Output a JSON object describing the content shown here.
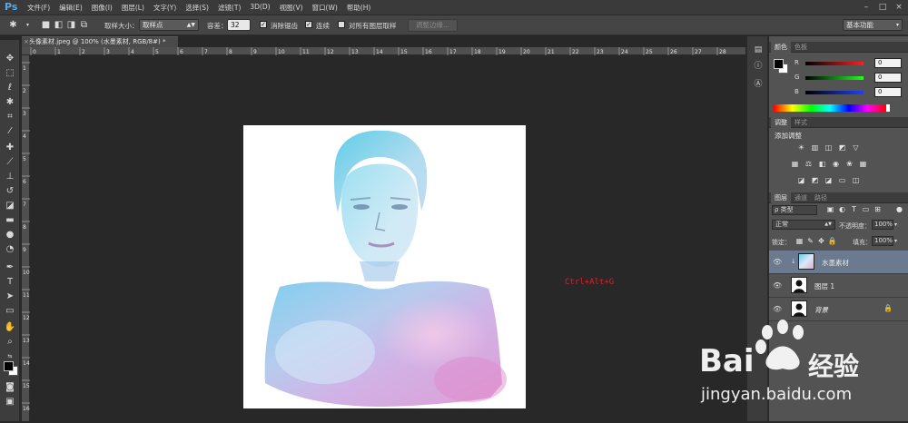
{
  "app": {
    "logo": "Ps"
  },
  "menu": [
    "文件(F)",
    "编辑(E)",
    "图像(I)",
    "图层(L)",
    "文字(Y)",
    "选择(S)",
    "滤镜(T)",
    "3D(D)",
    "视图(V)",
    "窗口(W)",
    "帮助(H)"
  ],
  "options": {
    "sample_size_label": "取样大小：",
    "sample_size_value": "取样点",
    "tolerance_label": "容差：",
    "tolerance_value": "32",
    "antialias_label": "消除锯齿",
    "contiguous_label": "连续",
    "all_layers_label": "对所有图层取样",
    "refine_edge_label": "调整边缘...",
    "workspace_value": "基本功能"
  },
  "document": {
    "tab_title": "头像素材.jpeg @ 100% (水墨素材, RGB/8#) *",
    "tab_close": "×"
  },
  "ruler_h_labels": [
    "0",
    "1",
    "2",
    "3",
    "4",
    "5",
    "6",
    "7",
    "8",
    "9",
    "10",
    "11",
    "12",
    "13",
    "14",
    "15",
    "16",
    "17",
    "18",
    "19",
    "20",
    "21",
    "22",
    "23",
    "24",
    "25",
    "26",
    "27",
    "28",
    "29"
  ],
  "ruler_v_labels": [
    "1",
    "2",
    "3",
    "4",
    "5",
    "6",
    "7",
    "8",
    "9",
    "10",
    "11",
    "12",
    "13",
    "14",
    "15",
    "16"
  ],
  "annotation_text": "Ctrl+Alt+G",
  "color_panel": {
    "tabs": [
      "颜色",
      "色板"
    ],
    "channels": [
      {
        "name": "R",
        "value": "0",
        "color": "#d83030"
      },
      {
        "name": "G",
        "value": "0",
        "color": "#30c030"
      },
      {
        "name": "B",
        "value": "0",
        "color": "#3040e0"
      }
    ]
  },
  "adjust_panel": {
    "tabs": [
      "调整",
      "样式"
    ],
    "heading": "添加调整"
  },
  "layers_panel": {
    "tabs": [
      "图层",
      "通道",
      "路径"
    ],
    "kind_label": "ρ 类型",
    "blend_mode": "正常",
    "opacity_label": "不透明度：",
    "opacity_value": "100%",
    "lock_label": "锁定：",
    "fill_label": "填充：",
    "fill_value": "100%",
    "layers": [
      {
        "name": "水墨素材",
        "selected": true
      },
      {
        "name": "图层 1",
        "selected": false
      },
      {
        "name": "背景",
        "selected": false
      }
    ]
  },
  "watermark": {
    "brand_left": "Bai",
    "brand_right": "经验",
    "url": "jingyan.baidu.com"
  },
  "colors": {
    "accent_blue": "#52a9e8",
    "shortcut_red": "#d8222a",
    "selected_layer": "#6b7a8f"
  }
}
